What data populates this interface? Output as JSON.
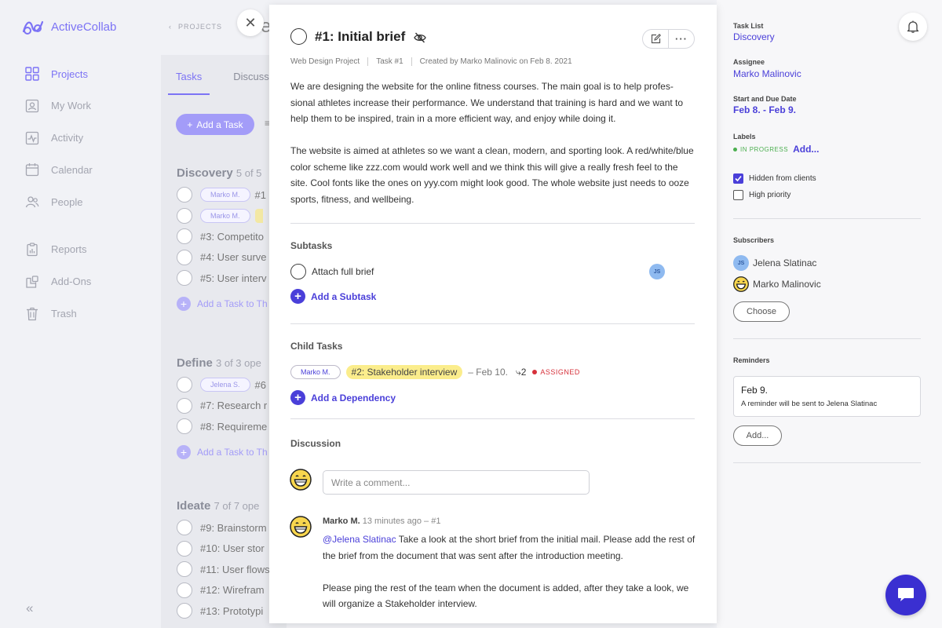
{
  "app": {
    "name": "ActiveCollab",
    "brand_color": "#7c73f5",
    "accent_color": "#4a3fd9"
  },
  "sidebar": {
    "items": [
      {
        "label": "Projects",
        "icon": "projects-grid-icon",
        "active": true
      },
      {
        "label": "My Work",
        "icon": "my-work-icon"
      },
      {
        "label": "Activity",
        "icon": "activity-icon"
      },
      {
        "label": "Calendar",
        "icon": "calendar-icon"
      },
      {
        "label": "People",
        "icon": "people-icon"
      },
      {
        "label": "Reports",
        "icon": "reports-icon"
      },
      {
        "label": "Add-Ons",
        "icon": "add-ons-icon"
      },
      {
        "label": "Trash",
        "icon": "trash-icon"
      }
    ],
    "collapse_glyph": "«"
  },
  "background": {
    "breadcrumb_glyph": "‹",
    "breadcrumb": "PROJECTS",
    "title_fragment": "e",
    "tabs": [
      "Tasks",
      "Discussio"
    ],
    "add_task_label": "Add a Task",
    "groups": [
      {
        "title": "Discovery",
        "sub": "5 of 5",
        "rows": [
          "#1",
          "",
          "#3: Competito",
          "#4: User surve",
          "#5: User interv"
        ],
        "pills": [
          "Marko M.",
          "Marko M."
        ],
        "add_label": "Add a Task to Th"
      },
      {
        "title": "Define",
        "sub": "3 of 3 ope",
        "rows": [
          "#6",
          "#7: Research r",
          "#8: Requireme"
        ],
        "pills": [
          "Jelena S."
        ],
        "add_label": "Add a Task to Th"
      },
      {
        "title": "Ideate",
        "sub": "7 of 7 ope",
        "rows": [
          "#9: Brainstorm",
          "#10: User stor",
          "#11: User flows",
          "#12: Wirefram",
          "#13: Prototypi"
        ]
      }
    ]
  },
  "task": {
    "title": "#1: Initial brief",
    "meta": {
      "project": "Web Design Project",
      "number": "Task #1",
      "created": "Created by Marko Malinovic on Feb 8. 2021"
    },
    "description": [
      "We are designing the website for the online fitness courses. The main goal is to help profes-sional athletes increase their performance. We understand that training is hard and we want to help them to be inspired, train in a more efficient way, and enjoy while doing it.",
      "The website is aimed at athletes so we want a clean, modern, and sporting look. A red/white/blue color scheme like zzz.com would work well and we think this will give a really fresh feel to the site. Cool fonts like the ones on yyy.com might look good. The whole website just needs to ooze sports, fitness, and wellbeing."
    ],
    "subtasks_title": "Subtasks",
    "subtask": {
      "label": "Attach full brief",
      "assignee_initials": "JS"
    },
    "add_subtask": "Add a Subtask",
    "child_tasks_title": "Child Tasks",
    "child_task": {
      "assignee": "Marko M.",
      "name": "#2: Stakeholder interview",
      "date": "– Feb 10.",
      "subtask_glyph": "⤷",
      "subtask_count": "2",
      "status": "ASSIGNED"
    },
    "add_dependency": "Add a Dependency",
    "discussion_title": "Discussion",
    "comment_placeholder": "Write a comment...",
    "comment": {
      "author": "Marko M.",
      "time": "13 minutes ago – #1",
      "mention": "@Jelena Slatinac",
      "line1": " Take a look at the short brief from the initial mail. Please add the rest of the brief from the document that was sent after the introduction meeting.",
      "line2": "Please ping the rest of the team when the document is added, after they take a look, we will organize a Stakeholder interview."
    }
  },
  "details": {
    "task_list_label": "Task List",
    "task_list": "Discovery",
    "assignee_label": "Assignee",
    "assignee": "Marko Malinovic",
    "dates_label": "Start and Due Date",
    "dates": "Feb 8. - Feb 9.",
    "labels_label": "Labels",
    "label_status": "IN PROGRESS",
    "labels_add": "Add...",
    "hidden_from_clients": "Hidden from clients",
    "hidden_checked": true,
    "high_priority": "High priority",
    "high_priority_checked": false,
    "subscribers_label": "Subscribers",
    "subscribers": [
      {
        "name": "Jelena Slatinac",
        "initials": "JS"
      },
      {
        "name": "Marko Malinovic"
      }
    ],
    "choose_label": "Choose",
    "reminders_label": "Reminders",
    "reminder": {
      "date": "Feb 9.",
      "text": "A reminder will be sent to Jelena Slatinac"
    },
    "reminder_add": "Add..."
  }
}
